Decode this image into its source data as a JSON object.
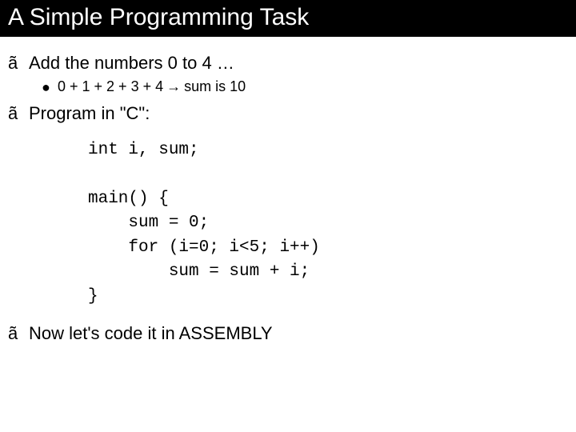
{
  "title": "A Simple Programming Task",
  "bullets": {
    "b1": {
      "marker": "ã",
      "text": "Add the numbers 0 to 4 …",
      "sub": {
        "marker": "●",
        "expr": "0 + 1 + 2 + 3 + 4",
        "arrow": "→",
        "result": "sum is 10"
      }
    },
    "b2": {
      "marker": "ã",
      "text": "Program in \"C\":"
    },
    "b3": {
      "marker": "ã",
      "text": "Now let's code it in ASSEMBLY"
    }
  },
  "code": "int i, sum;\n\nmain() {\n    sum = 0;\n    for (i=0; i<5; i++)\n        sum = sum + i;\n}"
}
